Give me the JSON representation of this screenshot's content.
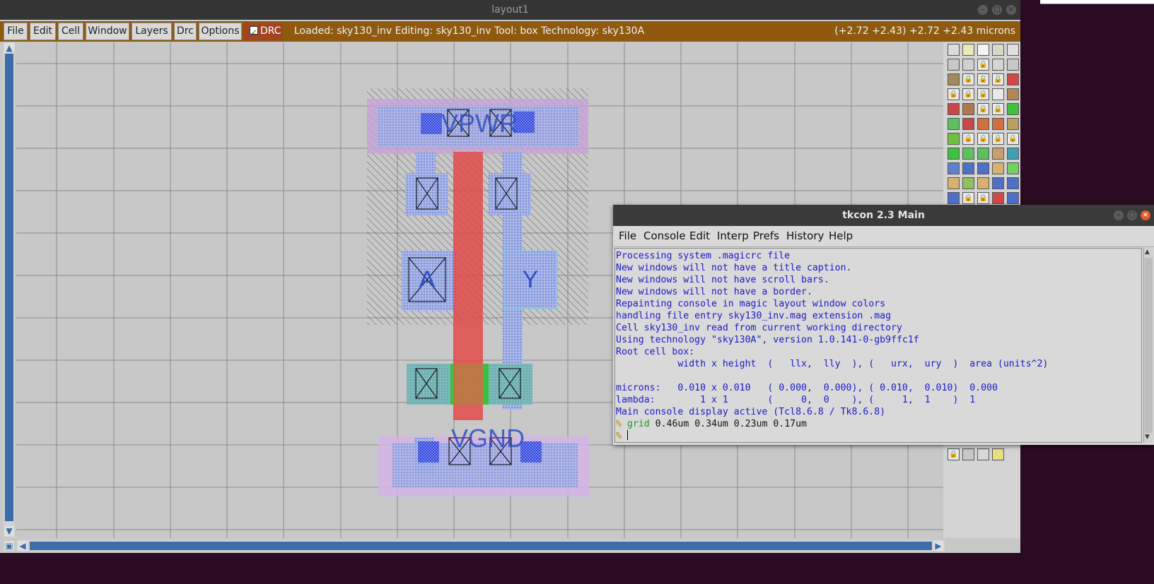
{
  "magic_window": {
    "title": "layout1",
    "menu": [
      "File",
      "Edit",
      "Cell",
      "Window",
      "Layers",
      "Drc",
      "Options"
    ],
    "drc_label": "DRC",
    "drc_checked": true,
    "status": "Loaded: sky130_inv Editing: sky130_inv Tool: box  Technology: sky130A",
    "coords": "(+2.72 +2.43) +2.72 +2.43 microns"
  },
  "layout_labels": {
    "vpwr": "VPWR",
    "vgnd": "VGND",
    "a": "A",
    "y": "Y"
  },
  "tkcon": {
    "title": "tkcon 2.3 Main",
    "menu": [
      "File",
      "Console",
      "Edit",
      "Interp",
      "Prefs",
      "History",
      "Help"
    ],
    "lines": [
      "Processing system .magicrc file",
      "New windows will not have a title caption.",
      "New windows will not have scroll bars.",
      "New windows will not have a border.",
      "Repainting console in magic layout window colors",
      "handling file entry sky130_inv.mag extension .mag",
      "Cell sky130_inv read from current working directory",
      "Using technology \"sky130A\", version 1.0.141-0-gb9ffc1f",
      "Root cell box:",
      "           width x height  (   llx,  lly  ), (   urx,  ury  )  area (units^2)",
      "",
      "microns:   0.010 x 0.010   ( 0.000,  0.000), ( 0.010,  0.010)  0.000",
      "lambda:        1 x 1       (     0,  0    ), (     1,  1    )  1",
      "Main console display active (Tcl8.6.8 / Tk8.6.8)"
    ],
    "prompt": "%",
    "cmd_word": "grid",
    "cmd_args": "0.46um 0.34um 0.23um 0.17um",
    "prompt2": "%"
  },
  "colors": {
    "menubar": "#8f5a10",
    "drc": "#a04422",
    "console_text": "#1a1acb",
    "scroll": "#3b6ea8"
  }
}
